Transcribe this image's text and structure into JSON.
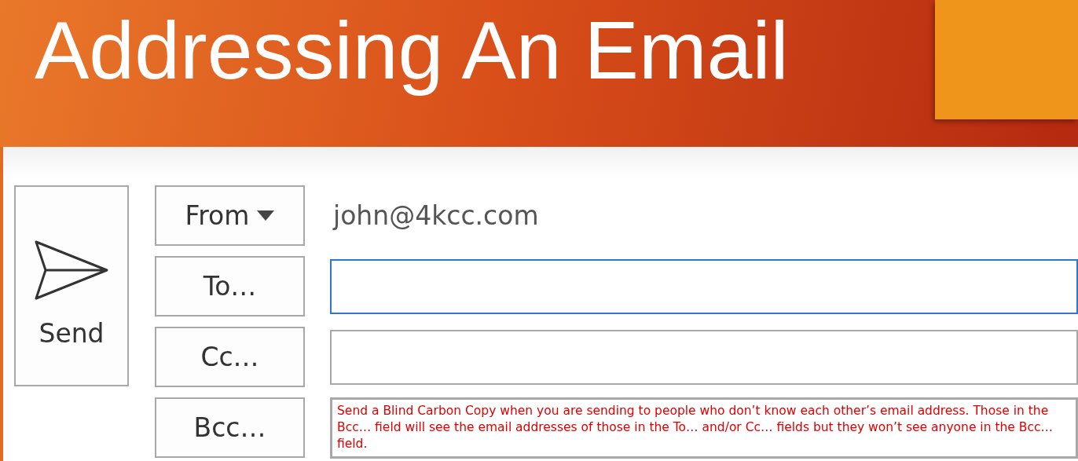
{
  "slide": {
    "title": "Addressing An Email"
  },
  "send_button": {
    "label": "Send"
  },
  "rows": [
    {
      "kind": "from",
      "label": "From",
      "value": "john@4kcc.com"
    },
    {
      "kind": "field",
      "label": "To…",
      "focused": true
    },
    {
      "kind": "field",
      "label": "Cc…",
      "focused": false
    },
    {
      "kind": "field",
      "label": "Bcc…",
      "focused": false,
      "note": "Send a Blind Carbon Copy when you are sending to people who don’t know each other’s email address. Those in the Bcc… field will see the email addresses of those in the To… and/or Cc… fields but they won’t see anyone in the Bcc… field."
    }
  ]
}
